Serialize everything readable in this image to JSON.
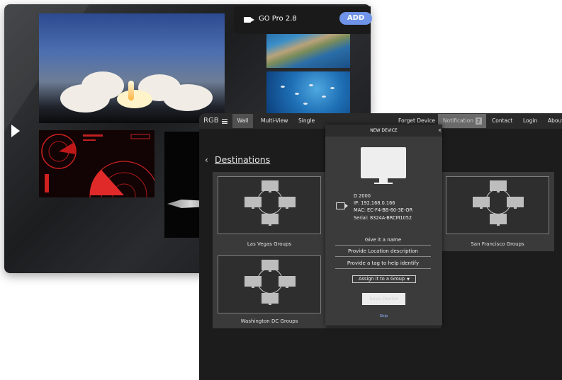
{
  "gopro": {
    "device": "GO Pro 2.8",
    "add_label": "ADD"
  },
  "nav": {
    "brand": "RGB",
    "tabs": [
      "Wall",
      "Multi-View",
      "Single"
    ],
    "forget": "Forget Device",
    "notification": "Notification",
    "notification_count": "2",
    "contact": "Contact",
    "login": "Login",
    "about": "About"
  },
  "destinations": {
    "title": "Destinations",
    "groups": [
      "Las Vegas Groups",
      "San Francisco Groups",
      "Washington DC Groups"
    ]
  },
  "modal": {
    "title": "NEW DEVICE",
    "close": "×",
    "device_name": "D 2000",
    "ip": "IP: 192.168.0.166",
    "mac": "MAC: EC-F4-BB-60-3E-OR",
    "serial": "Serial: 8324A-BRCM1052",
    "field_name": "Give it a name",
    "field_location": "Provide Location description",
    "field_tag": "Provide a tag to help identify",
    "group_select": "Assign it to a Group",
    "save": "Save Device",
    "skip": "Skip"
  },
  "icons": [
    "play-icon",
    "camera-icon",
    "hamburger-icon",
    "chevron-left-icon",
    "monitor-icon",
    "network-diagram-icon",
    "close-icon"
  ]
}
